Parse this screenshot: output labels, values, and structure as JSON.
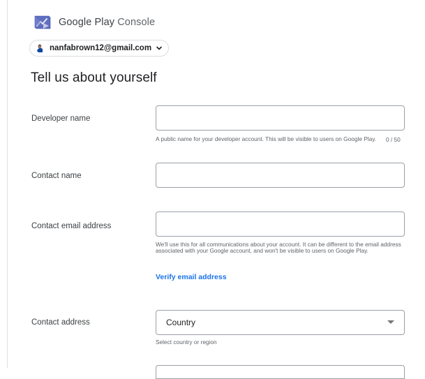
{
  "header": {
    "brand": "Google Play",
    "product": "Console",
    "logo_icon": "play-console-logo-icon"
  },
  "account": {
    "email": "nanfabrown12@gmail.com",
    "avatar_icon": "avatar-icon",
    "chevron_icon": "chevron-down-icon"
  },
  "page": {
    "title": "Tell us about yourself"
  },
  "form": {
    "developer_name": {
      "label": "Developer name",
      "value": "",
      "helper": "A public name for your developer account. This will be visible to users on Google Play.",
      "counter": "0 / 50"
    },
    "contact_name": {
      "label": "Contact name",
      "value": ""
    },
    "contact_email": {
      "label": "Contact email address",
      "value": "",
      "helper": "We'll use this for all communications about your account. It can be different to the email address associated with your Google account, and won't be visible to users on Google Play.",
      "verify_link": "Verify email address"
    },
    "contact_address": {
      "label": "Contact address",
      "select_value": "Country",
      "helper": "Select country or region",
      "caret_icon": "caret-down-icon"
    }
  },
  "colors": {
    "link": "#1a73e8",
    "border": "#9aa0a6",
    "text": "#202124",
    "muted": "#5f6368"
  }
}
